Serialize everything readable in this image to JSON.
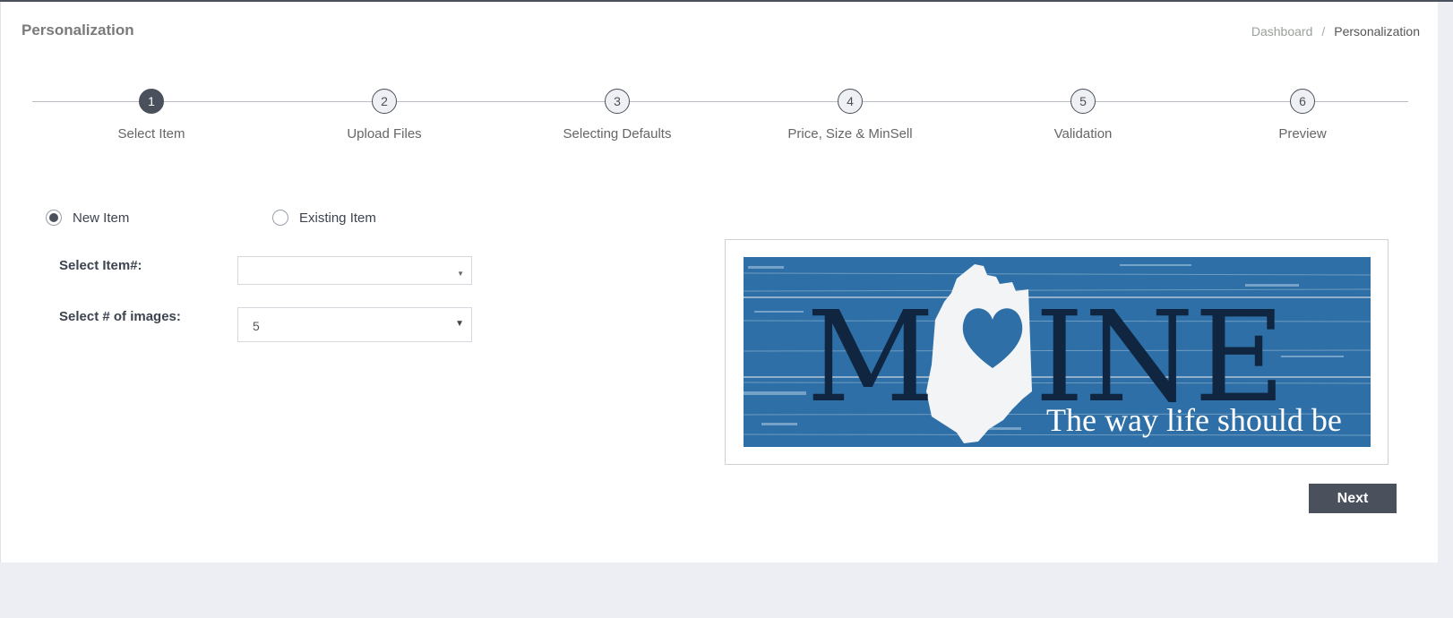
{
  "header": {
    "title": "Personalization",
    "breadcrumb": {
      "parent": "Dashboard",
      "separator": "/",
      "current": "Personalization"
    }
  },
  "steps": [
    {
      "number": "1",
      "label": "Select Item",
      "active": true
    },
    {
      "number": "2",
      "label": "Upload Files",
      "active": false
    },
    {
      "number": "3",
      "label": "Selecting Defaults",
      "active": false
    },
    {
      "number": "4",
      "label": "Price, Size & MinSell",
      "active": false
    },
    {
      "number": "5",
      "label": "Validation",
      "active": false
    },
    {
      "number": "6",
      "label": "Preview",
      "active": false
    }
  ],
  "item_type": {
    "new_label": "New Item",
    "existing_label": "Existing Item",
    "selected": "new"
  },
  "form": {
    "item_label": "Select Item#:",
    "item_value": "",
    "images_label": "Select # of images:",
    "images_value": "5"
  },
  "preview": {
    "sign_text": "MAINE",
    "tagline": "The way life should be",
    "colors": {
      "background": "#2d6fa6",
      "letters": "#0f2540",
      "state": "#f2f4f6"
    }
  },
  "actions": {
    "next_label": "Next"
  },
  "colors": {
    "accent": "#4a505c",
    "page_bg": "#eceef3"
  }
}
